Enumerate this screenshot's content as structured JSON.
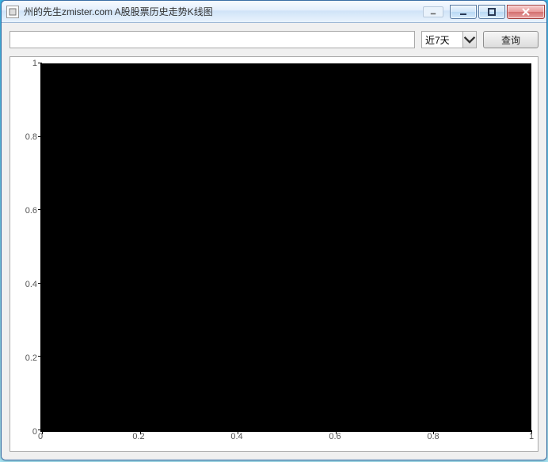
{
  "window": {
    "title": "州的先生zmister.com A股股票历史走势K线图",
    "controls": {
      "minimize": "minimize-icon",
      "maximize": "maximize-icon",
      "close": "close-icon"
    }
  },
  "toolbar": {
    "search_value": "",
    "search_placeholder": "",
    "range_selected": "近7天",
    "query_label": "查询"
  },
  "chart_data": {
    "type": "line",
    "series": [],
    "title": "",
    "xlabel": "",
    "ylabel": "",
    "xlim": [
      0,
      1
    ],
    "ylim": [
      0,
      1
    ],
    "xticks": [
      0,
      0.2,
      0.4,
      0.6,
      0.8,
      1
    ],
    "yticks": [
      0,
      0.2,
      0.4,
      0.6,
      0.8,
      1
    ],
    "xticklabels": [
      "0",
      "0.2",
      "0.4",
      "0.6",
      "0.8",
      "1"
    ],
    "yticklabels": [
      "0",
      "0.2",
      "0.4",
      "0.6",
      "0.8",
      "1"
    ],
    "background": "#000000"
  }
}
